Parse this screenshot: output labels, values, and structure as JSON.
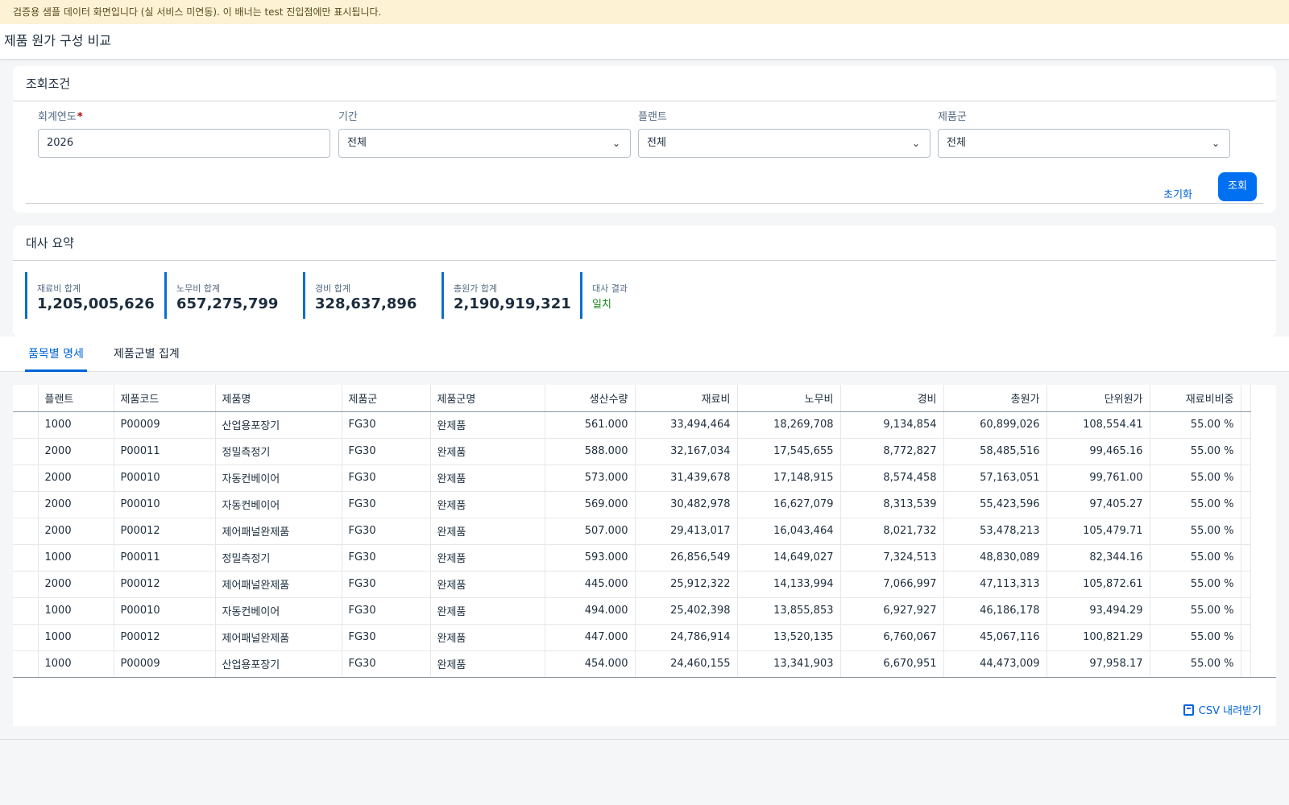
{
  "banner": "검증용 샘플 데이터 화면입니다 (실 서비스 미연동). 이 배너는 test 진입점에만 표시됩니다.",
  "page_title": "제품 원가 구성 비교",
  "filter": {
    "title": "조회조건",
    "fields": [
      {
        "label": "회계연도",
        "required": "*",
        "value": "2026"
      },
      {
        "label": "기간",
        "value": "전체"
      },
      {
        "label": "플랜트",
        "value": "전체"
      },
      {
        "label": "제품군",
        "value": "전체"
      }
    ],
    "reset_label": "초기화",
    "search_label": "조회"
  },
  "summary": {
    "title": "대사 요약",
    "kpis": [
      {
        "label": "재료비 합계",
        "value": "1,205,005,626"
      },
      {
        "label": "노무비 합계",
        "value": "657,275,799"
      },
      {
        "label": "경비 합계",
        "value": "328,637,896"
      },
      {
        "label": "총원가 합계",
        "value": "2,190,919,321"
      },
      {
        "label": "대사 결과",
        "value": "일치"
      }
    ]
  },
  "tabs": [
    "품목별 명세",
    "제품군별 집계"
  ],
  "table": {
    "headers": [
      "플랜트",
      "제품코드",
      "제품명",
      "제품군",
      "제품군명",
      "생산수량",
      "재료비",
      "노무비",
      "경비",
      "총원가",
      "단위원가",
      "재료비비중"
    ],
    "rows": [
      [
        "1000",
        "P00009",
        "산업용포장기",
        "FG30",
        "완제품",
        "561.000",
        "33,494,464",
        "18,269,708",
        "9,134,854",
        "60,899,026",
        "108,554.41",
        "55.00 %"
      ],
      [
        "2000",
        "P00011",
        "정밀측정기",
        "FG30",
        "완제품",
        "588.000",
        "32,167,034",
        "17,545,655",
        "8,772,827",
        "58,485,516",
        "99,465.16",
        "55.00 %"
      ],
      [
        "2000",
        "P00010",
        "자동컨베이어",
        "FG30",
        "완제품",
        "573.000",
        "31,439,678",
        "17,148,915",
        "8,574,458",
        "57,163,051",
        "99,761.00",
        "55.00 %"
      ],
      [
        "2000",
        "P00010",
        "자동컨베이어",
        "FG30",
        "완제품",
        "569.000",
        "30,482,978",
        "16,627,079",
        "8,313,539",
        "55,423,596",
        "97,405.27",
        "55.00 %"
      ],
      [
        "2000",
        "P00012",
        "제어패널완제품",
        "FG30",
        "완제품",
        "507.000",
        "29,413,017",
        "16,043,464",
        "8,021,732",
        "53,478,213",
        "105,479.71",
        "55.00 %"
      ],
      [
        "1000",
        "P00011",
        "정밀측정기",
        "FG30",
        "완제품",
        "593.000",
        "26,856,549",
        "14,649,027",
        "7,324,513",
        "48,830,089",
        "82,344.16",
        "55.00 %"
      ],
      [
        "2000",
        "P00012",
        "제어패널완제품",
        "FG30",
        "완제품",
        "445.000",
        "25,912,322",
        "14,133,994",
        "7,066,997",
        "47,113,313",
        "105,872.61",
        "55.00 %"
      ],
      [
        "1000",
        "P00010",
        "자동컨베이어",
        "FG30",
        "완제품",
        "494.000",
        "25,402,398",
        "13,855,853",
        "6,927,927",
        "46,186,178",
        "93,494.29",
        "55.00 %"
      ],
      [
        "1000",
        "P00012",
        "제어패널완제품",
        "FG30",
        "완제품",
        "447.000",
        "24,786,914",
        "13,520,135",
        "6,760,067",
        "45,067,116",
        "100,821.29",
        "55.00 %"
      ],
      [
        "1000",
        "P00009",
        "산업용포장기",
        "FG30",
        "완제품",
        "454.000",
        "24,460,155",
        "13,341,903",
        "6,670,951",
        "44,473,009",
        "97,958.17",
        "55.00 %"
      ]
    ]
  },
  "csv_label": "CSV 내려받기",
  "icons": {
    "dropdown": "chevron-down-icon",
    "csv": "export-icon"
  },
  "colors": {
    "accent": "#0070f2",
    "banner_bg": "#fdf3d4",
    "match_ok": "#188918"
  }
}
